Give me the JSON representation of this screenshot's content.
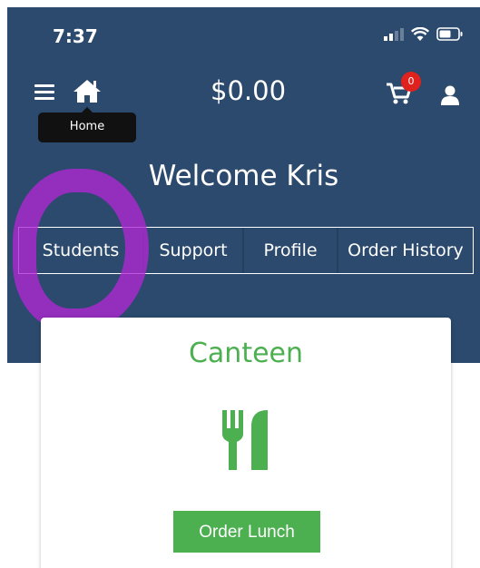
{
  "status_bar": {
    "time": "7:37"
  },
  "header": {
    "home_tooltip": "Home",
    "balance": "$0.00",
    "cart_count": "0",
    "welcome": "Welcome Kris"
  },
  "nav": {
    "tabs": [
      {
        "label": "Students"
      },
      {
        "label": "Support"
      },
      {
        "label": "Profile"
      },
      {
        "label": "Order History"
      }
    ]
  },
  "card": {
    "title": "Canteen",
    "button_label": "Order Lunch",
    "icon": "cutlery-icon"
  },
  "colors": {
    "header_bg": "#2b4a6d",
    "accent_green": "#4caf50",
    "badge_red": "#e0221e",
    "marker_purple": "#b126d4"
  }
}
